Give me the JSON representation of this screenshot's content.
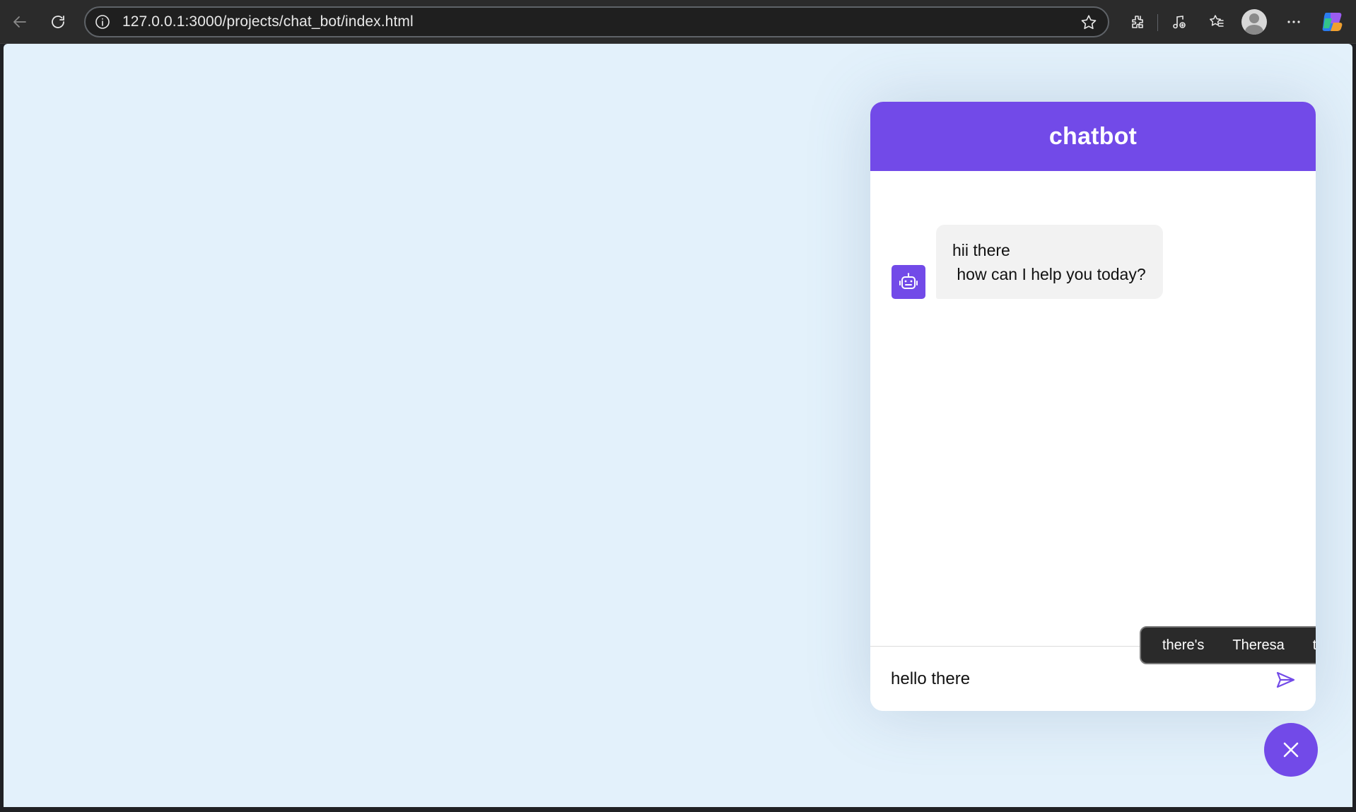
{
  "browser": {
    "url": "127.0.0.1:3000/projects/chat_bot/index.html",
    "icons": [
      "back-arrow-icon",
      "reload-icon",
      "site-info-icon",
      "star-icon",
      "extensions-icon",
      "media-icon",
      "favorites-icon",
      "profile-icon",
      "more-icon",
      "copilot-icon"
    ]
  },
  "chat": {
    "title": "chatbot",
    "messages": [
      {
        "sender": "bot",
        "text": "hii there\n how can I help you today?"
      }
    ],
    "input_value": "hello there",
    "suggestions": [
      "there's",
      "Theresa",
      "therefore"
    ]
  },
  "colors": {
    "accent": "#724ae8",
    "page_background": "#e3f1fb",
    "bubble_background": "#f2f2f2"
  }
}
